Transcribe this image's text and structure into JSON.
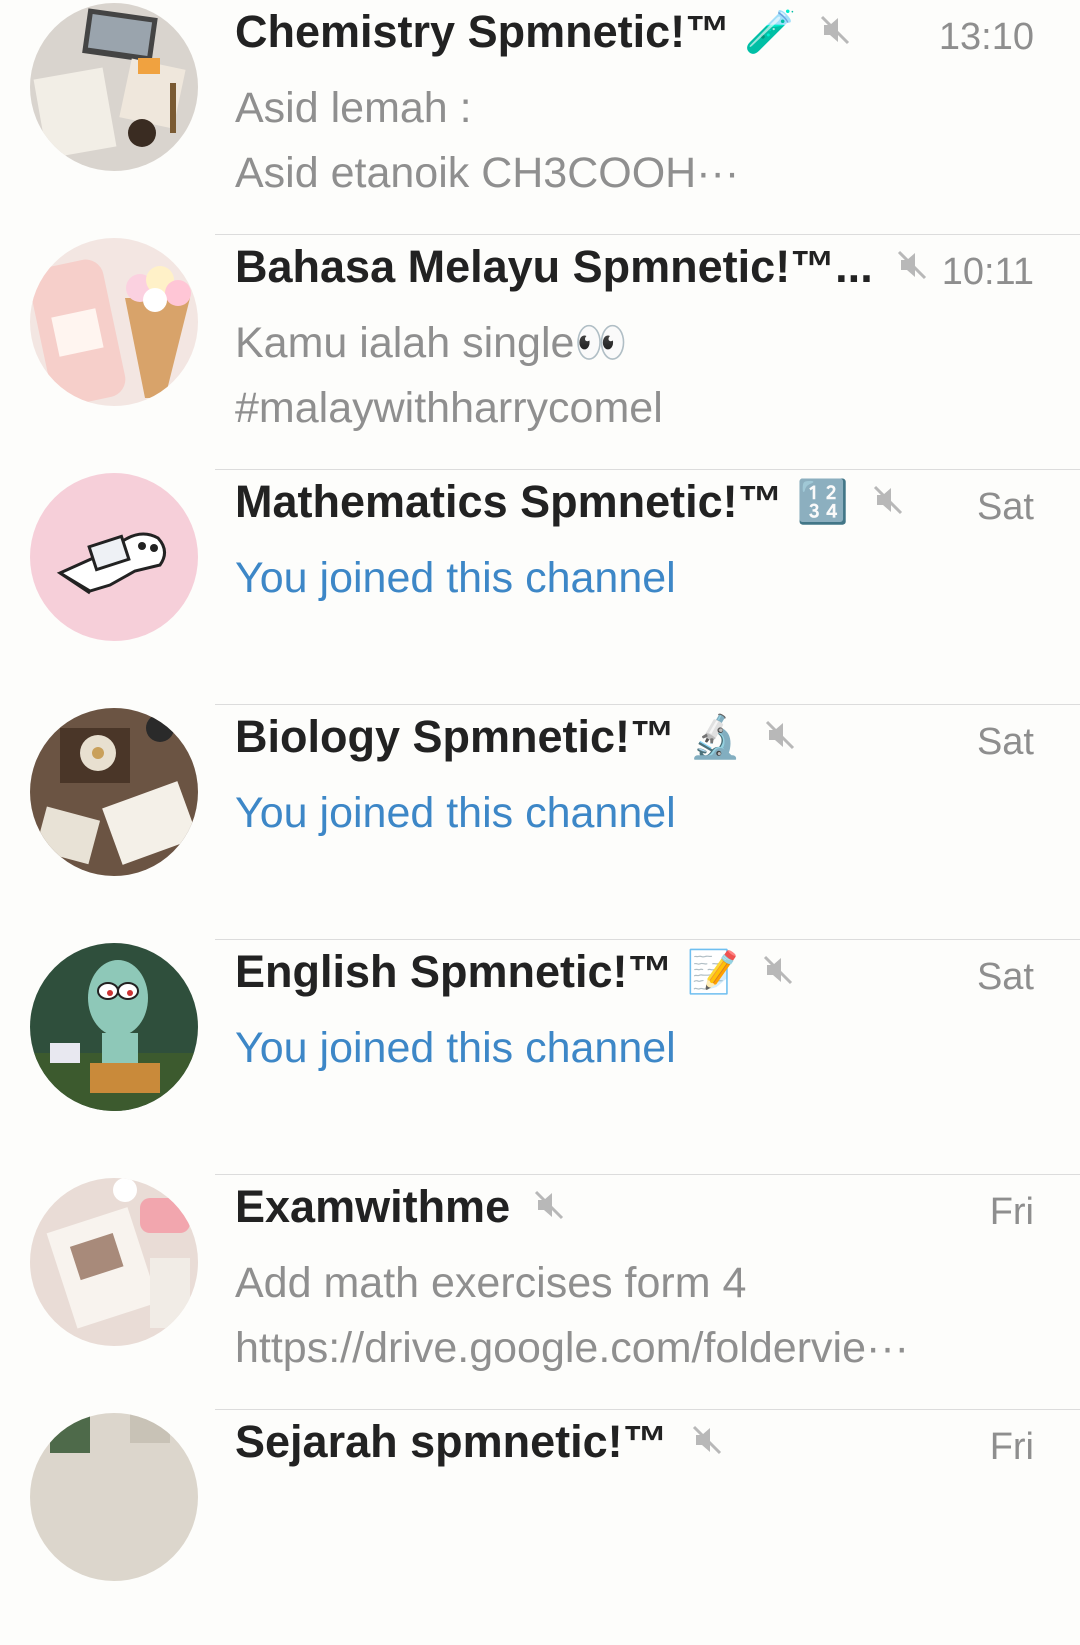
{
  "chats": [
    {
      "title": "Chemistry Spmnetic!™",
      "emoji": "🧪",
      "time": "13:10",
      "preview_line1": "Asid lemah :",
      "preview_line2": "Asid etanoik CH3COOH···",
      "muted": true,
      "avatar_icon": "study-desk-photo"
    },
    {
      "title": "Bahasa Melayu Spmnetic!™...",
      "emoji": "",
      "time": "10:11",
      "preview_line1": "Kamu ialah single👀",
      "preview_line2": "#malaywithharrycomel",
      "muted": true,
      "avatar_icon": "peach-latte-photo"
    },
    {
      "title": "Mathematics Spmnetic!™",
      "emoji": "🔢",
      "time": "Sat",
      "preview_line1": "You joined this channel",
      "preview_line2": "",
      "muted": true,
      "avatar_icon": "cartoon-laptop-photo"
    },
    {
      "title": "Biology Spmnetic!™",
      "emoji": "🔬",
      "time": "Sat",
      "preview_line1": "You joined this channel",
      "preview_line2": "",
      "muted": true,
      "avatar_icon": "candle-books-photo"
    },
    {
      "title": "English Spmnetic!™",
      "emoji": "📝",
      "time": "Sat",
      "preview_line1": "You joined this channel",
      "preview_line2": "",
      "muted": true,
      "avatar_icon": "squidward-photo"
    },
    {
      "title": "Examwithme",
      "emoji": "",
      "time": "Fri",
      "preview_line1": "Add math exercises form 4",
      "preview_line2": "https://drive.google.com/foldervie···",
      "muted": true,
      "avatar_icon": "notes-photo"
    },
    {
      "title": "Sejarah spmnetic!™",
      "emoji": "",
      "time": "Fri",
      "preview_line1": "",
      "preview_line2": "",
      "muted": true,
      "avatar_icon": "plants-photo"
    }
  ],
  "colors": {
    "joined_text": "#3d87c7",
    "preview_text": "#8f8f8f",
    "title_text": "#222222",
    "background": "#fdfdfb"
  }
}
